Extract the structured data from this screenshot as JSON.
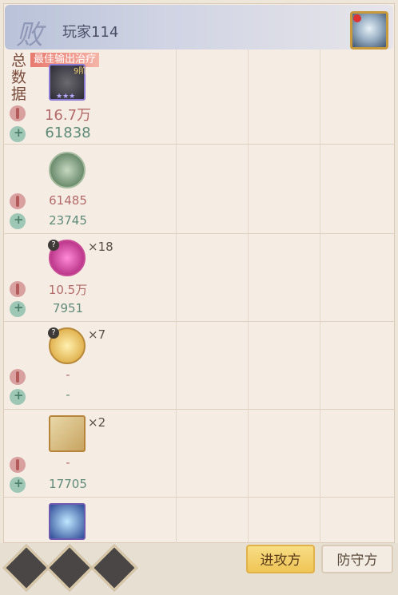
{
  "header": {
    "result_label": "败",
    "player_name": "玩家114"
  },
  "summary": {
    "label": "总数据",
    "best_badge": "最佳输出治疗",
    "level": "9阶",
    "damage": "16.7万",
    "heal": "61838"
  },
  "rows": [
    {
      "damage": "61485",
      "heal": "23745",
      "count": "",
      "has_q": false
    },
    {
      "damage": "10.5万",
      "heal": "7951",
      "count": "×18",
      "has_q": true
    },
    {
      "damage": "-",
      "heal": "-",
      "count": "×7",
      "has_q": true
    },
    {
      "damage": "-",
      "heal": "17705",
      "count": "×2",
      "has_q": false
    }
  ],
  "tabs": {
    "attacker": "进攻方",
    "defender": "防守方"
  }
}
